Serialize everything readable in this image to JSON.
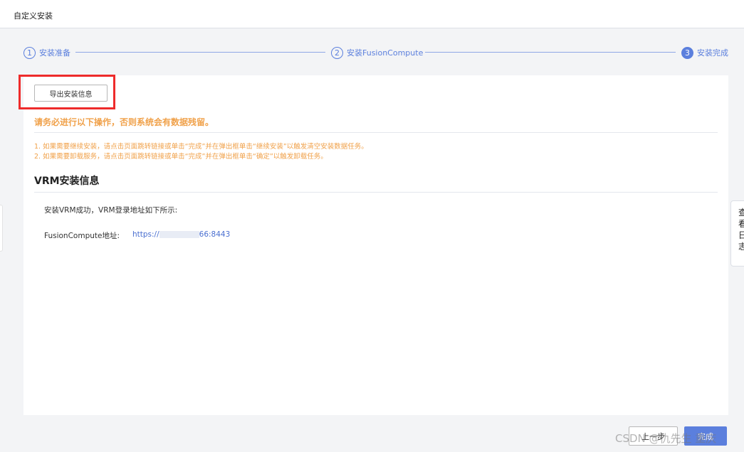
{
  "window": {
    "title": "自定义安装"
  },
  "stepper": {
    "steps": [
      {
        "num": "1",
        "label": "安装准备"
      },
      {
        "num": "2",
        "label": "安装FusionCompute"
      },
      {
        "num": "3",
        "label": "安装完成"
      }
    ],
    "current_step": 3
  },
  "main": {
    "export_button_label": "导出安装信息",
    "warning_title": "请务必进行以下操作，否则系统会有数据残留。",
    "warnings": [
      "1. 如果需要继续安装，请点击页面跳转链接或单击“完成”并在弹出框单击“继续安装”以触发清空安装数据任务。",
      "2. 如果需要卸载服务，请点击页面跳转链接或单击“完成”并在弹出框单击“确定”以触发卸载任务。"
    ],
    "section_title": "VRM安装信息",
    "success_text": "安装VRM成功，VRM登录地址如下所示:",
    "address_label": "FusionCompute地址:",
    "address_prefix": "https://",
    "address_suffix": "66:8443"
  },
  "side_panel": {
    "chars": [
      "查",
      "看",
      "日",
      "志"
    ]
  },
  "footer": {
    "prev_label": "上一步",
    "done_label": "完成",
    "watermark": "CSDN @仇先生 重庆"
  },
  "colors": {
    "accent": "#5b7fdd",
    "warning": "#f0a14a",
    "highlight_box": "#ee2b2b",
    "link": "#4a6fd0"
  }
}
